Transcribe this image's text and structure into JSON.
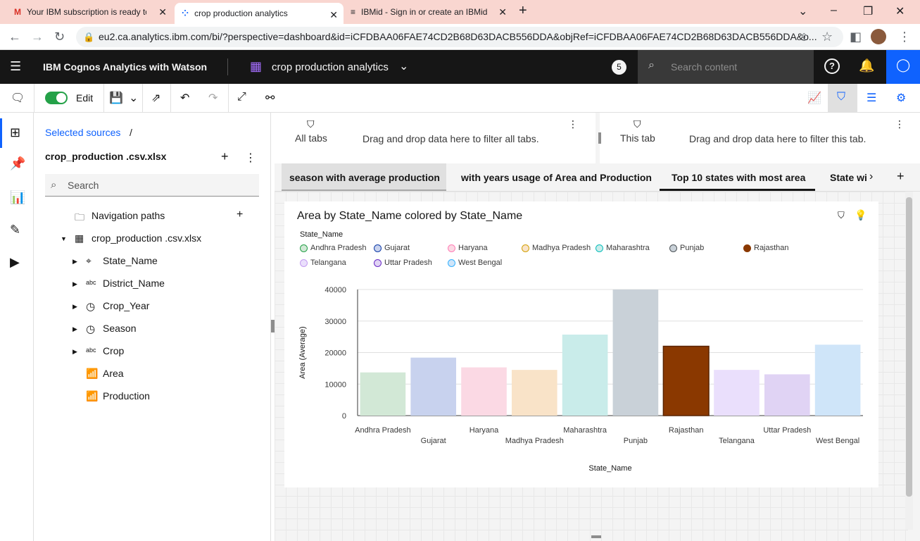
{
  "browser": {
    "tabs": [
      {
        "label": "Your IBM subscription is ready to",
        "favicon": "gmail-icon"
      },
      {
        "label": "crop production analytics",
        "favicon": "cognos-icon"
      },
      {
        "label": "IBMid - Sign in or create an IBMid",
        "favicon": "ibm-icon"
      }
    ],
    "url": "eu2.ca.analytics.ibm.com/bi/?perspective=dashboard&id=iCFDBAA06FAE74CD2B68D63DACB556DDA&objRef=iCFDBAA06FAE74CD2B68D63DACB556DDA&o..."
  },
  "header": {
    "brand": "IBM Cognos Analytics with Watson",
    "doc_title": "crop production analytics",
    "notifications_count": "5",
    "search_placeholder": "Search content"
  },
  "toolbar": {
    "edit_label": "Edit"
  },
  "datapanel": {
    "breadcrumb": "Selected sources",
    "breadcrumb_sep": "/",
    "source_name": "crop_production .csv.xlsx",
    "search_placeholder": "Search",
    "nav_paths": "Navigation paths",
    "table_name": "crop_production .csv.xlsx",
    "fields": [
      {
        "label": "State_Name",
        "type_icon": "location-icon"
      },
      {
        "label": "District_Name",
        "type_icon": "abc"
      },
      {
        "label": "Crop_Year",
        "type_icon": "clock-icon"
      },
      {
        "label": "Season",
        "type_icon": "clock-icon"
      },
      {
        "label": "Crop",
        "type_icon": "abc"
      },
      {
        "label": "Area",
        "type_icon": "measure-icon"
      },
      {
        "label": "Production",
        "type_icon": "measure-icon"
      }
    ]
  },
  "filters": {
    "all_tabs_label": "All tabs",
    "all_tabs_hint": "Drag and drop data here to filter all tabs.",
    "this_tab_label": "This tab",
    "this_tab_hint": "Drag and drop data here to filter this tab."
  },
  "dashboard_tabs": [
    "season with average production",
    "with years usage of Area and Production",
    "Top 10 states with most area",
    "State wi"
  ],
  "chart_data": {
    "type": "bar",
    "title": "Area by State_Name colored by State_Name",
    "legend_title": "State_Name",
    "xlabel": "State_Name",
    "ylabel": "Area (Average)",
    "ylim": [
      0,
      40000
    ],
    "yticks": [
      0,
      10000,
      20000,
      30000,
      40000
    ],
    "yticklabels": [
      "0",
      "10000",
      "20000",
      "30000",
      "40000"
    ],
    "categories": [
      "Andhra Pradesh",
      "Gujarat",
      "Haryana",
      "Madhya Pradesh",
      "Maharashtra",
      "Punjab",
      "Rajasthan",
      "Telangana",
      "Uttar Pradesh",
      "West Bengal"
    ],
    "values": [
      13700,
      18400,
      15300,
      14500,
      25700,
      40000,
      22000,
      14500,
      13100,
      22500
    ],
    "colors": [
      "#d2e8d6",
      "#c8d2ee",
      "#fbd9e4",
      "#f9e3c8",
      "#c9ecea",
      "#c9d1d8",
      "#8a3800",
      "#eadffc",
      "#e0d3f4",
      "#cfe5f9"
    ],
    "legend_colors": [
      "#24a148",
      "#0f3ba6",
      "#ff7eb6",
      "#d2a106",
      "#08bdba",
      "#4d5358",
      "#8a3800",
      "#c39bf0",
      "#6929c4",
      "#33b1ff"
    ],
    "grid": true,
    "legend_position": "top-left"
  }
}
